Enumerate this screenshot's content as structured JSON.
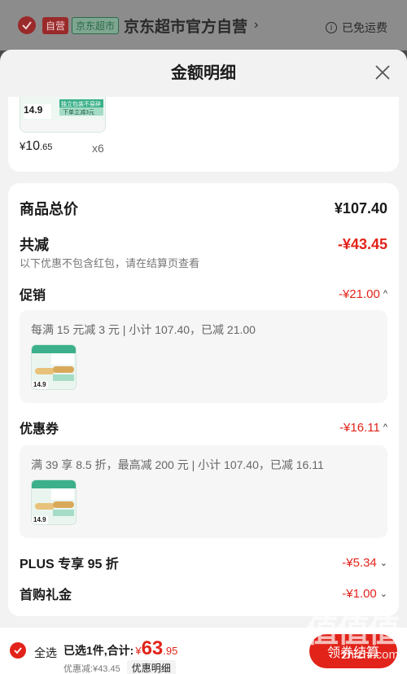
{
  "store": {
    "self_tag": "自营",
    "jd_tag": "京东超市",
    "name": "京东超市官方自营",
    "free_shipping": "已免运费"
  },
  "sheet": {
    "title": "金额明细"
  },
  "product": {
    "price_yen": "¥",
    "price_int": "10",
    "price_dec": ".65",
    "quantity": "x6",
    "art_price": "14.9",
    "art_banner": "独立包装不易碎",
    "art_sub": "下单立减3元"
  },
  "summary": {
    "total_label": "商品总价",
    "total_value": "¥107.40",
    "reduce_label": "共减",
    "reduce_value": "-¥43.45",
    "note": "以下优惠不包含红包，请在结算页查看"
  },
  "promo": {
    "label": "促销",
    "value": "-¥21.00",
    "detail": "每满 15 元减 3 元 | 小计 107.40，已减 21.00"
  },
  "coupon": {
    "label": "优惠券",
    "value": "-¥16.11",
    "detail": "满 39 享 8.5 折，最高减 200 元 | 小计 107.40，已减 16.11"
  },
  "plus": {
    "label": "PLUS 专享 95 折",
    "value": "-¥5.34"
  },
  "first_gift": {
    "label": "首购礼金",
    "value": "-¥1.00"
  },
  "bottom": {
    "select_all": "全选",
    "selected_text": "已选1件,合计:",
    "total_yen": "¥",
    "total_int": "63",
    "total_dec": ".95",
    "discount_text": "优惠减:¥43.45",
    "detail_link": "优惠明细",
    "coupon_button": "领券结算"
  },
  "watermark": {
    "url": "zhizhi.com"
  },
  "colors": {
    "accent": "#e2231a",
    "sheet_bg": "#f2f2f2"
  }
}
